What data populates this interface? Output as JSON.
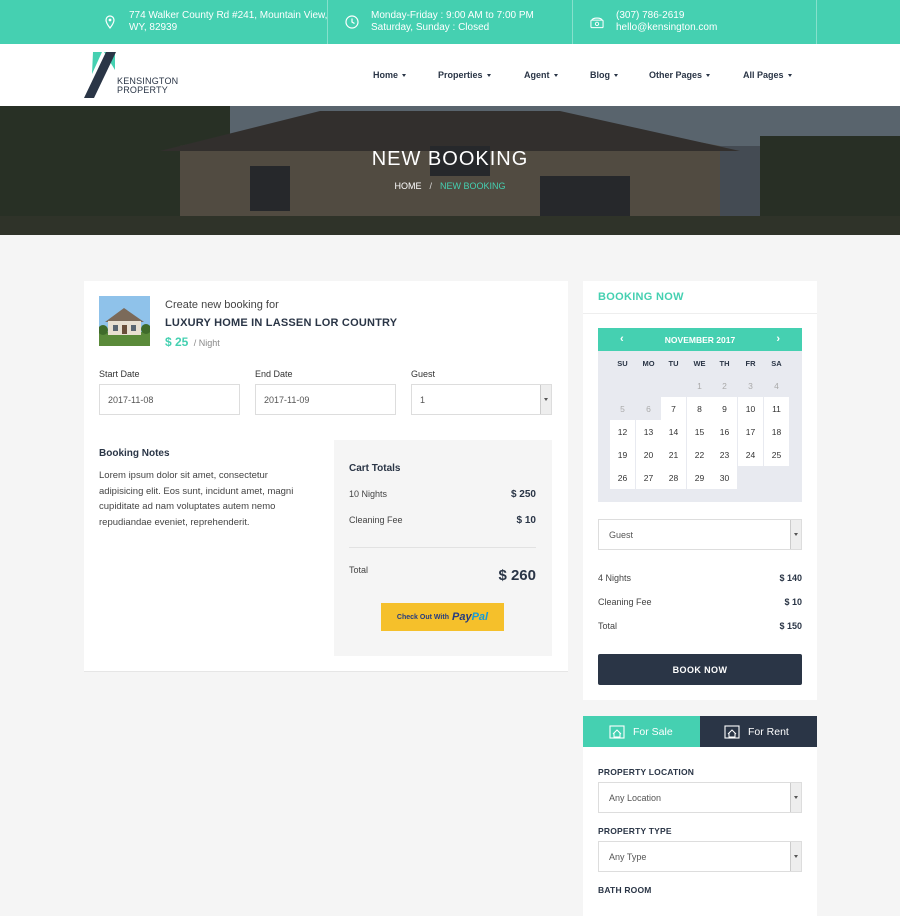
{
  "topbar": {
    "address": [
      "774 Walker County Rd #241, Mountain View,",
      "WY, 82939"
    ],
    "hours": [
      "Monday-Friday : 9:00 AM to 7:00 PM",
      "Saturday, Sunday : Closed"
    ],
    "contact": [
      "(307) 786-2619",
      "hello@kensington.com"
    ],
    "icons": [
      "map-pin-icon",
      "clock-icon",
      "phone-icon"
    ]
  },
  "logo": {
    "line1": "KENSINGTON",
    "line2": "PROPERTY"
  },
  "nav": [
    "Home",
    "Properties",
    "Agent",
    "Blog",
    "Other Pages",
    "All Pages"
  ],
  "hero": {
    "title": "NEW BOOKING",
    "crumb_home": "HOME",
    "crumb_sep": "/",
    "crumb_current": "NEW BOOKING"
  },
  "booking": {
    "prehead": "Create new booking for",
    "title": "LUXURY HOME IN LASSEN LOR COUNTRY",
    "price": "$ 25",
    "per": "/ Night",
    "fields": {
      "start_label": "Start Date",
      "start_value": "2017-11-08",
      "end_label": "End Date",
      "end_value": "2017-11-09",
      "guest_label": "Guest",
      "guest_value": "1"
    },
    "notes_title": "Booking Notes",
    "notes_text": "Lorem ipsum dolor sit amet, consectetur adipisicing elit. Eos sunt, incidunt amet, magni cupiditate ad nam voluptates autem nemo repudiandae eveniet, reprehenderit.",
    "cart": {
      "title": "Cart Totals",
      "rows": [
        {
          "label": "10 Nights",
          "value": "$ 250"
        },
        {
          "label": "Cleaning Fee",
          "value": "$ 10"
        }
      ],
      "total_label": "Total",
      "total_value": "$ 260",
      "paypal_prefix": "Check Out With",
      "paypal_pay": "Pay",
      "paypal_pal": "Pal"
    }
  },
  "sidebar": {
    "title": "BOOKING NOW",
    "calendar": {
      "month": "NOVEMBER 2017",
      "prev": "‹",
      "next": "›",
      "dow": [
        "SU",
        "MO",
        "TU",
        "WE",
        "TH",
        "FR",
        "SA"
      ],
      "weeks": [
        [
          "",
          "",
          "",
          "1",
          "2",
          "3",
          "4"
        ],
        [
          "5",
          "6",
          "7",
          "8",
          "9",
          "10",
          "11"
        ],
        [
          "12",
          "13",
          "14",
          "15",
          "16",
          "17",
          "18"
        ],
        [
          "19",
          "20",
          "21",
          "22",
          "23",
          "24",
          "25"
        ],
        [
          "26",
          "27",
          "28",
          "29",
          "30",
          "",
          ""
        ]
      ],
      "unavailable": [
        "1",
        "2",
        "3",
        "4",
        "5",
        "6"
      ]
    },
    "guest_placeholder": "Guest",
    "summary": [
      {
        "label": "4 Nights",
        "value": "$ 140"
      },
      {
        "label": "Cleaning Fee",
        "value": "$ 10"
      },
      {
        "label": "Total",
        "value": "$ 150"
      }
    ],
    "book_button": "BOOK NOW"
  },
  "search": {
    "tab_sale": "For Sale",
    "tab_rent": "For Rent",
    "location_label": "PROPERTY LOCATION",
    "location_value": "Any Location",
    "type_label": "PROPERTY TYPE",
    "type_value": "Any Type",
    "bath_label": "BATH ROOM"
  },
  "colors": {
    "accent": "#45d0b1",
    "dark": "#2a3546",
    "paypal": "#f5c02b"
  }
}
